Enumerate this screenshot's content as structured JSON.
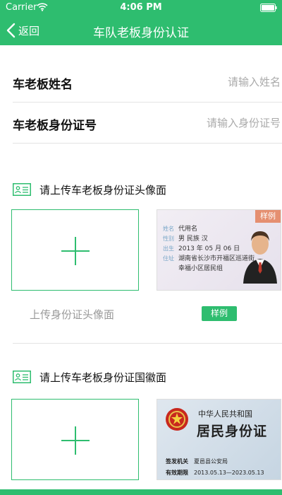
{
  "status_bar": {
    "carrier": "Carrier",
    "time": "4:06 PM"
  },
  "nav": {
    "back_label": "返回",
    "title": "车队老板身份认证"
  },
  "form": {
    "name": {
      "label": "车老板姓名",
      "placeholder": "请输入姓名"
    },
    "id_number": {
      "label": "车老板身份证号",
      "placeholder": "请输入身份证号"
    }
  },
  "sections": [
    {
      "title": "请上传车老板身份证头像面",
      "upload_caption": "上传身份证头像面",
      "sample_badge": "样例",
      "sample_ribbon": "样例",
      "sample_card": {
        "rows": [
          {
            "key": "姓名",
            "value": "代用名"
          },
          {
            "key": "性别",
            "value": "男    民族  汉"
          },
          {
            "key": "出生",
            "value": "2013 年 05 月 06 日"
          },
          {
            "key": "住址",
            "value": "湖南省长沙市开福区巡道街"
          },
          {
            "key": "",
            "value": "幸福小区居民组"
          }
        ]
      }
    },
    {
      "title": "请上传车老板身份证国徽面",
      "sample_card": {
        "country": "中华人民共和国",
        "card_title": "居民身份证",
        "authority_key": "签发机关",
        "authority_value": "夏邑县公安局",
        "validity_key": "有效期限",
        "validity_value": "2013.05.13—2023.05.13"
      }
    }
  ],
  "colors": {
    "brand": "#2ebd6f",
    "ribbon": "#e58f70",
    "placeholder": "#aaaaaa"
  },
  "icons": [
    "wifi-icon",
    "battery-icon",
    "chevron-left-icon",
    "id-card-icon",
    "plus-icon",
    "person-icon",
    "emblem-icon"
  ]
}
